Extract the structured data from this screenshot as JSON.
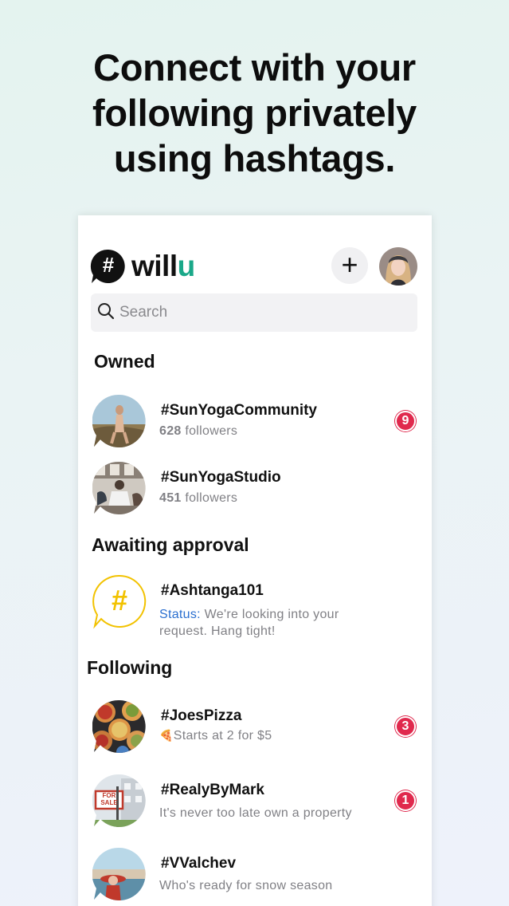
{
  "headline": {
    "line1": "Connect with your",
    "line2": "following privately",
    "line3": "using hashtags."
  },
  "header": {
    "logo_symbol": "#",
    "logo_word_main": "will",
    "logo_word_accent": "u",
    "accent_color": "#1aa889",
    "add_symbol": "+"
  },
  "search": {
    "placeholder": "Search"
  },
  "sections": {
    "owned": "Owned",
    "awaiting": "Awaiting approval",
    "following": "Following"
  },
  "owned": [
    {
      "title": "#SunYogaCommunity",
      "count": "628",
      "count_label": "followers",
      "badge": "9"
    },
    {
      "title": "#SunYogaStudio",
      "count": "451",
      "count_label": "followers"
    }
  ],
  "awaiting": {
    "title": "#Ashtanga101",
    "placeholder_symbol": "#",
    "status_label": "Status:",
    "status_line1": " We're looking into your",
    "status_line2": "request. Hang tight!"
  },
  "following": [
    {
      "title": "#JoesPizza",
      "subtitle_emoji": "🍕",
      "subtitle": "Starts at 2 for $5",
      "badge": "3"
    },
    {
      "title": "#RealyByMark",
      "subtitle": "It's never too late own a property",
      "badge": "1",
      "sign_line1": "FOR",
      "sign_line2": "SALE"
    },
    {
      "title": "#VValchev",
      "subtitle": "Who's ready for snow season"
    }
  ],
  "colors": {
    "badge": "#e0294d",
    "status": "#2a6fd0",
    "pending": "#f2c200"
  }
}
